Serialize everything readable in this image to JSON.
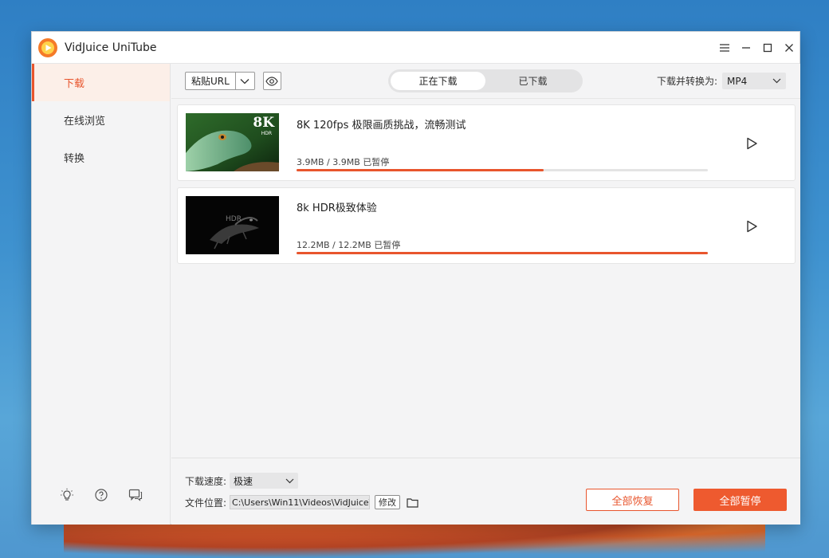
{
  "app": {
    "title": "VidJuice UniTube"
  },
  "window_controls": {
    "menu_icon": "menu-icon",
    "minimize_icon": "minimize-icon",
    "maximize_icon": "maximize-icon",
    "close_icon": "close-icon"
  },
  "sidebar": {
    "items": [
      {
        "label": "下载",
        "active": true
      },
      {
        "label": "在线浏览",
        "active": false
      },
      {
        "label": "转换",
        "active": false
      }
    ],
    "footer_icons": [
      "lightbulb-icon",
      "help-icon",
      "feedback-icon"
    ]
  },
  "toolbar": {
    "paste_label": "粘贴URL",
    "tabs": [
      {
        "label": "正在下载",
        "active": true
      },
      {
        "label": "已下载",
        "active": false
      }
    ],
    "convert_label": "下载并转换为:",
    "format_value": "MP4"
  },
  "downloads": [
    {
      "title": "8K 120fps 极限画质挑战，流畅测试",
      "status": "3.9MB / 3.9MB 已暂停",
      "progress": 0.6,
      "thumb_badge": "8K",
      "thumb_sub": "HDR"
    },
    {
      "title": "8k HDR极致体验",
      "status": "12.2MB / 12.2MB 已暂停",
      "progress": 1.0,
      "thumb_badge": "HDR"
    }
  ],
  "bottom": {
    "speed_label": "下载速度:",
    "speed_value": "极速",
    "location_label": "文件位置:",
    "location_value": "C:\\Users\\Win11\\Videos\\VidJuice\\",
    "modify_label": "修改",
    "resume_all_label": "全部恢复",
    "pause_all_label": "全部暂停"
  },
  "colors": {
    "accent": "#e8552d",
    "progress_track": "#e4e4e4"
  }
}
